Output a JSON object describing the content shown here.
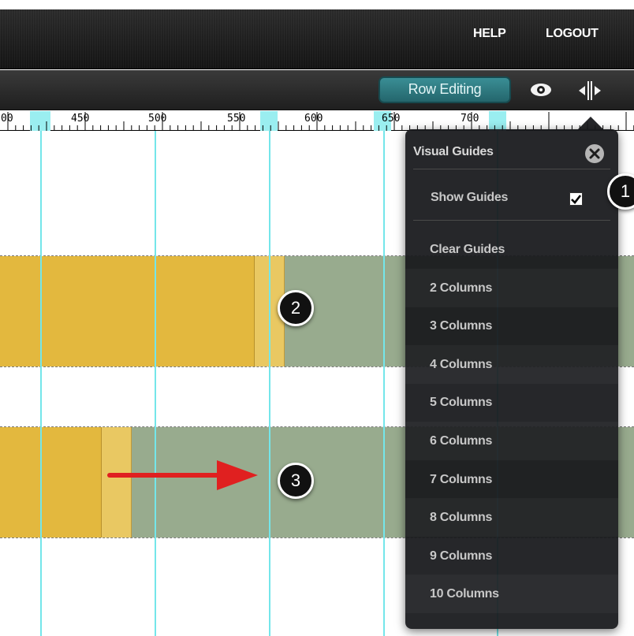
{
  "header": {
    "help": "HELP",
    "logout": "LOGOUT"
  },
  "toolbar": {
    "row_editing": "Row Editing",
    "icons": [
      "eye-icon",
      "splitter-icon"
    ]
  },
  "ruler": {
    "labels": [
      "00",
      "450",
      "500",
      "550",
      "600",
      "650",
      "700"
    ]
  },
  "visual_guides": {
    "title": "Visual Guides",
    "show_guides_label": "Show Guides",
    "show_guides_checked": true,
    "items": [
      "Clear Guides",
      "2 Columns",
      "3 Columns",
      "4 Columns",
      "5 Columns",
      "6 Columns",
      "7 Columns",
      "8 Columns",
      "9 Columns",
      "10 Columns"
    ]
  },
  "callouts": [
    "1",
    "2",
    "3"
  ],
  "colors": {
    "accent": "#2f7d84",
    "guide": "#74e6ea",
    "column_yellow": "#e3b83e",
    "column_green": "#98ab8e",
    "arrow": "#e02020"
  }
}
